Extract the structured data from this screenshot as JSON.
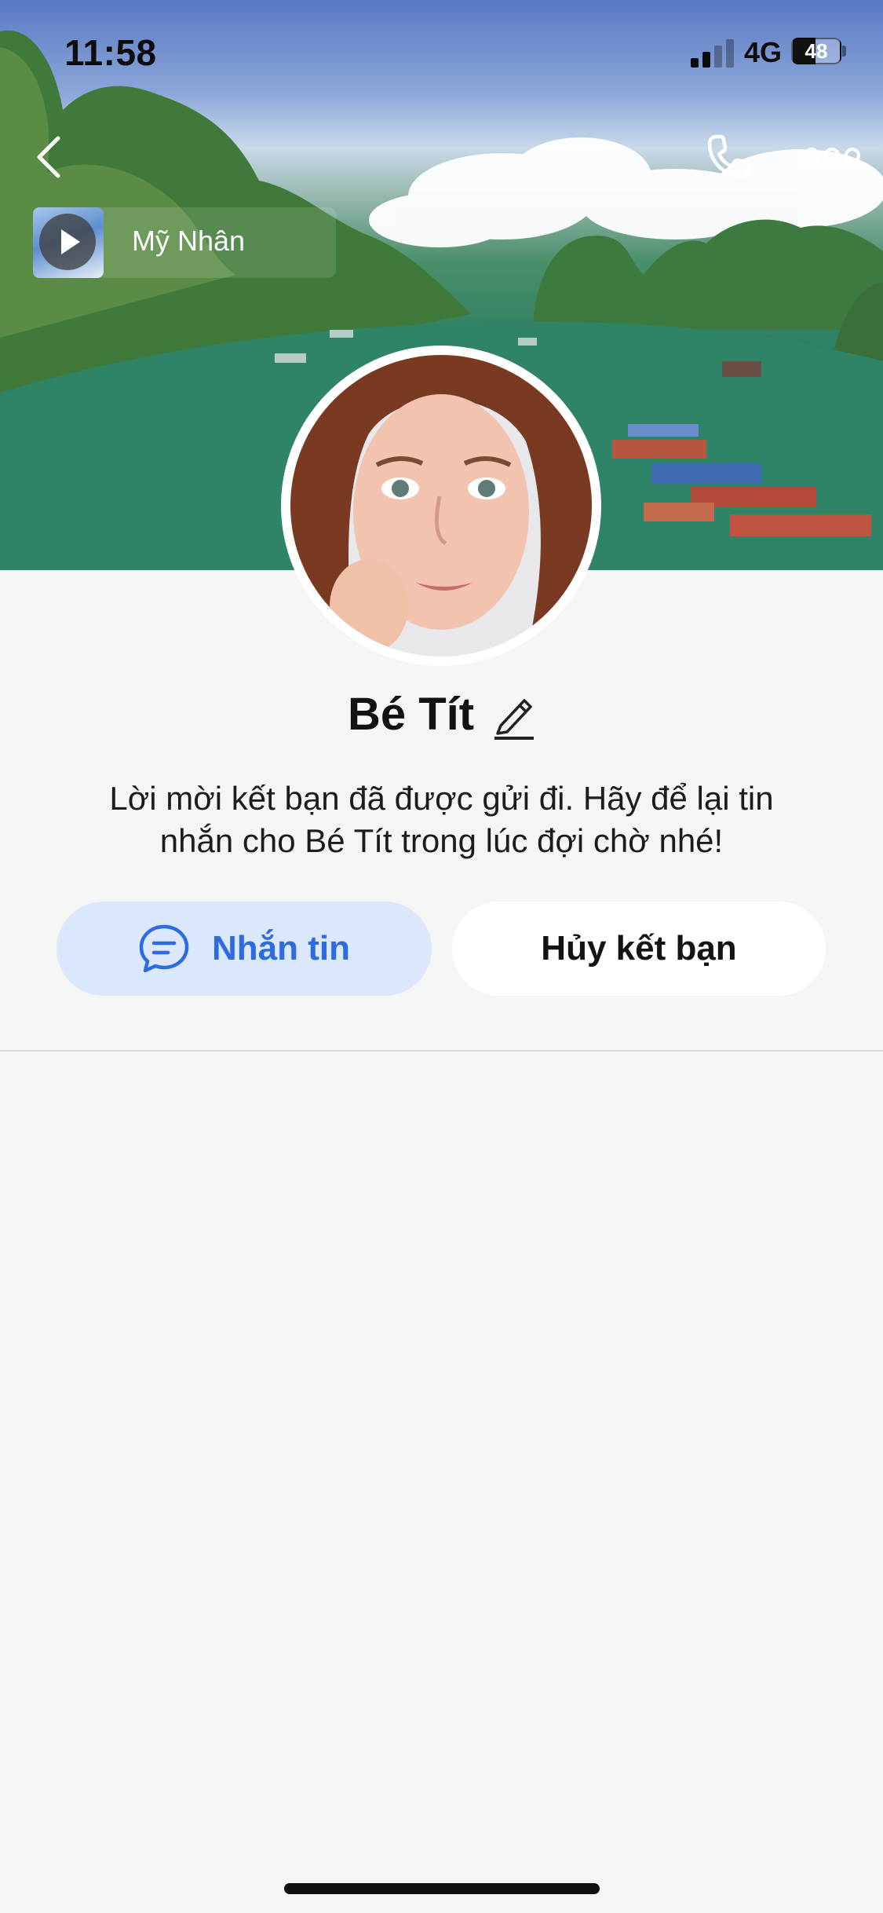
{
  "status_bar": {
    "time": "11:58",
    "network": "4G",
    "battery": "48"
  },
  "header": {
    "back_icon": "chevron-left-icon",
    "call_icon": "phone-icon",
    "more_icon": "ellipsis-icon"
  },
  "music": {
    "title": "Mỹ Nhân",
    "play_icon": "play-icon"
  },
  "profile": {
    "name": "Bé Tít",
    "edit_icon": "pencil-icon",
    "description": "Lời mời kết bạn đã được gửi đi. Hãy để lại tin nhắn cho Bé Tít trong lúc đợi chờ nhé!"
  },
  "actions": {
    "message_label": "Nhắn tin",
    "message_icon": "chat-bubble-icon",
    "unfriend_label": "Hủy kết bạn"
  },
  "colors": {
    "accent": "#2c6be0",
    "accent_bg": "#dbe8fb",
    "page_bg": "#f4f5f5"
  }
}
